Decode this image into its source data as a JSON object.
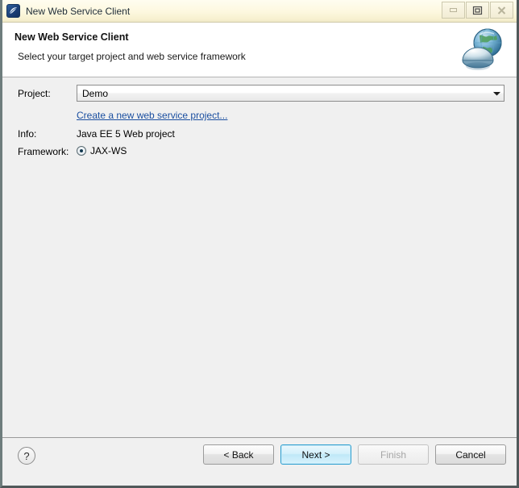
{
  "window": {
    "title": "New Web Service Client",
    "icon": "app-icon",
    "controls": [
      {
        "name": "minimize",
        "glyph": "minimize-icon"
      },
      {
        "name": "maximize",
        "glyph": "maximize-icon"
      },
      {
        "name": "close",
        "glyph": "close-icon"
      }
    ]
  },
  "header": {
    "title": "New Web Service Client",
    "description": "Select your target project and web service framework",
    "banner_icon": "globe-satellite-icon"
  },
  "form": {
    "project_label": "Project:",
    "project_value": "Demo",
    "project_arrow_icon": "chevron-down-icon",
    "create_project_link": "Create a new web service project...",
    "info_label": "Info:",
    "info_value": "Java EE 5 Web project",
    "framework_label": "Framework:",
    "framework_option": "JAX-WS"
  },
  "footer": {
    "help_label": "?",
    "back_label": "< Back",
    "next_label": "Next >",
    "finish_label": "Finish",
    "cancel_label": "Cancel"
  },
  "colors": {
    "titlebar": "#fdf8df",
    "header_bg": "#ffffff",
    "dialog_bg": "#f0f0f0",
    "link": "#1b4fa0",
    "focus_blue": "#2d9fd0",
    "disabled_text": "#a6a6a6"
  }
}
